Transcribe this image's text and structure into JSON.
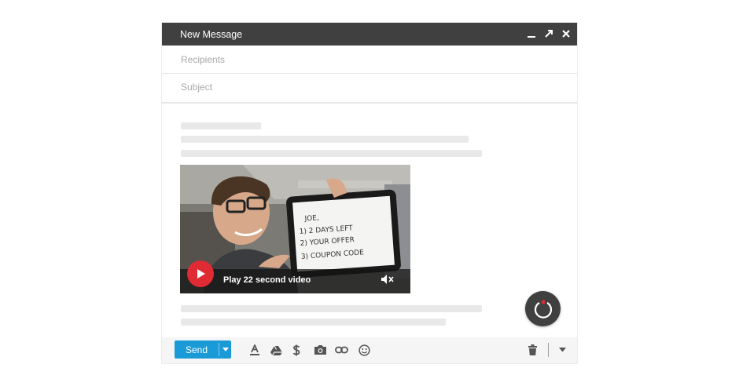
{
  "window": {
    "title": "New Message",
    "controls": [
      "minimize-icon",
      "expand-icon",
      "close-icon"
    ]
  },
  "recipients": {
    "placeholder": "Recipients",
    "value": ""
  },
  "subject": {
    "placeholder": "Subject",
    "value": ""
  },
  "video": {
    "play_label": "Play 22 second video",
    "thumbnail_note": {
      "line1": "JOE,",
      "line2": "1) 2 DAYS LEFT",
      "line3": "2) YOUR OFFER",
      "line4": "3) COUPON CODE"
    },
    "icons": [
      "play-icon",
      "mute-icon"
    ]
  },
  "toolbar": {
    "send_label": "Send",
    "icons": [
      "send-options-caret-icon",
      "text-format-icon",
      "drive-icon",
      "money-icon",
      "camera-icon",
      "link-icon",
      "emoji-icon",
      "trash-icon",
      "more-options-caret-icon"
    ]
  },
  "colors": {
    "titlebar": "#404040",
    "send_button": "#1a9ad6",
    "play_button": "#e02a34",
    "record_button": "#404040"
  }
}
